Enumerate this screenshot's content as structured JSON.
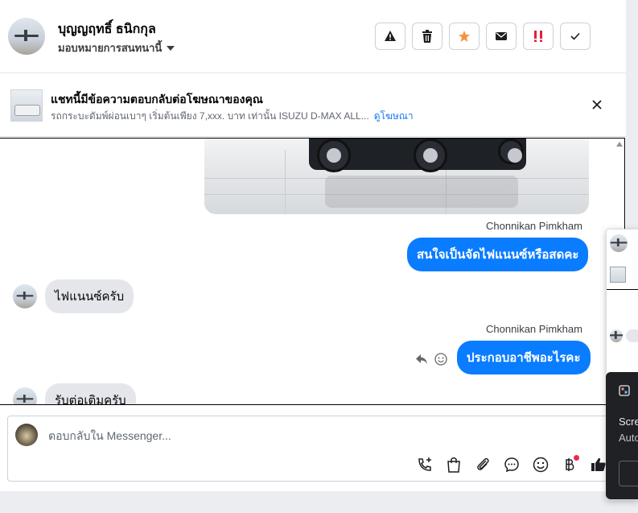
{
  "header": {
    "name": "บุญญฤทธิ์ ธนิกกุล",
    "assign_label": "มอบหมายการสนทนานี้",
    "actions": [
      "warning-icon",
      "trash-icon",
      "star-icon",
      "mail-icon",
      "urgent-icon",
      "check-icon"
    ]
  },
  "ad": {
    "title": "แชทนี้มีข้อความตอบกลับต่อโฆษณาของคุณ",
    "description": "รถกระบะดัมพ์ผ่อนเบาๆ เริ่มต้นเพียง 7,xxx. บาท เท่านั้น ISUZU D-MAX ALL...",
    "link": "ดูโฆษณา"
  },
  "messages": [
    {
      "sender": "Chonnikan Pimkham",
      "text": "สนใจเป็นจัดไฟแนนซ์หรือสดคะ",
      "direction": "out"
    },
    {
      "text": "ไฟแนนซ์ครับ",
      "direction": "in"
    },
    {
      "sender": "Chonnikan Pimkham",
      "text": "ประกอบอาชีพอะไรคะ",
      "direction": "out"
    },
    {
      "text": "รับต่อเติมครับ",
      "direction": "in"
    }
  ],
  "composer": {
    "placeholder": "ตอบกลับใน Messenger...",
    "tools": [
      "call-add-icon",
      "bag-icon",
      "attachment-icon",
      "chat-bubble-icon",
      "emoji-icon",
      "baht-icon",
      "thumbs-up-icon"
    ]
  },
  "side": {
    "label1": "Scre",
    "label2": "Auto"
  },
  "colors": {
    "accent": "#0a7cff",
    "star": "#f7923a",
    "urgent": "#e41e3f"
  }
}
